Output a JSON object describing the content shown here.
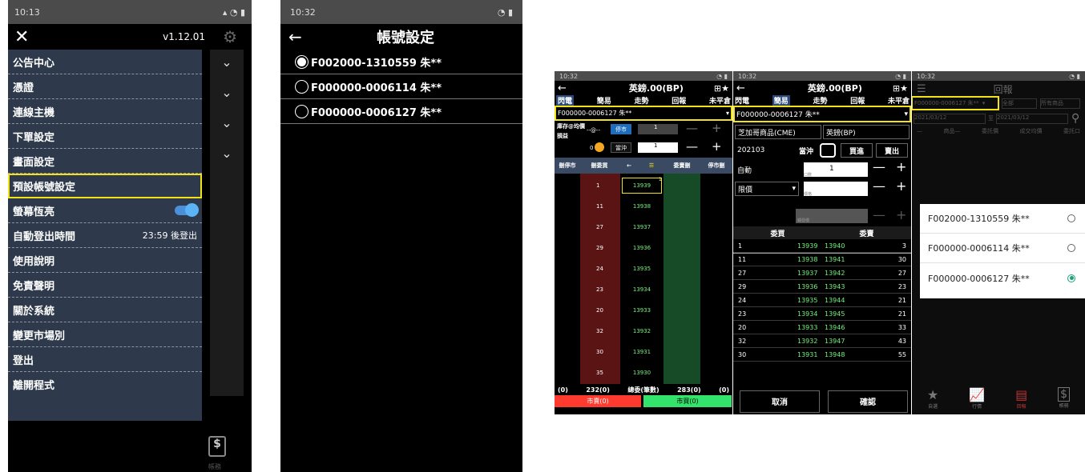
{
  "p1": {
    "status_time": "10:13",
    "version": "v1.12.01",
    "menu": [
      {
        "label": "公告中心"
      },
      {
        "label": "憑證"
      },
      {
        "label": "連線主機"
      },
      {
        "label": "下單設定"
      },
      {
        "label": "畫面設定"
      },
      {
        "label": "預設帳號設定"
      },
      {
        "label": "螢幕恆亮"
      },
      {
        "label": "自動登出時間",
        "value": "23:59 後登出"
      },
      {
        "label": "使用說明"
      },
      {
        "label": "免責聲明"
      },
      {
        "label": "關於系統"
      },
      {
        "label": "變更市場別"
      },
      {
        "label": "登出"
      },
      {
        "label": "離開程式"
      }
    ],
    "bottom_icon_label": "帳務"
  },
  "p2": {
    "status_time": "10:32",
    "title": "帳號設定",
    "accounts": [
      "F002000-1310559 朱**",
      "F000000-0006114 朱**",
      "F000000-0006127 朱**"
    ]
  },
  "p3": {
    "status_time": "10:32",
    "title": "英鎊.00(BP)",
    "tabs": [
      "閃電",
      "簡易",
      "走勢",
      "回報",
      "未平倉"
    ],
    "account": "F000000-0006127 朱**",
    "pos_label": "庫存@均價",
    "pos_value": "--@--",
    "pl_label": "損益",
    "pl_value": "0",
    "stop_label": "停市",
    "close_label": "當沖",
    "qty1": "1",
    "qty2": "1",
    "headers": [
      "刪停市",
      "刪委買",
      "←",
      "委賣刪",
      "停市刪"
    ],
    "ladder": [
      {
        "q": "1",
        "p": "13939",
        "mark": "1"
      },
      {
        "q": "11",
        "p": "13938"
      },
      {
        "q": "27",
        "p": "13937"
      },
      {
        "q": "29",
        "p": "13936"
      },
      {
        "q": "24",
        "p": "13935"
      },
      {
        "q": "23",
        "p": "13934"
      },
      {
        "q": "20",
        "p": "13933"
      },
      {
        "q": "32",
        "p": "13932"
      },
      {
        "q": "30",
        "p": "13931"
      },
      {
        "q": "35",
        "p": "13930"
      }
    ],
    "foot": [
      "(0)",
      "232(0)",
      "總委(筆數)",
      "283(0)",
      "(0)"
    ],
    "sell_btn": "市賣(0)",
    "buy_btn": "市買(0)"
  },
  "p4": {
    "status_time": "10:32",
    "title": "英鎊.00(BP)",
    "tabs": [
      "閃電",
      "簡易",
      "走勢",
      "回報",
      "未平倉"
    ],
    "account": "F000000-0006127 朱**",
    "exchange": "芝加哥商品(CME)",
    "product": "英鎊(BP)",
    "month": "202103",
    "daytrade": "當沖",
    "buy": "買進",
    "sell": "賣出",
    "auto": "自動",
    "qty": "1",
    "ordtype": "限價",
    "hint1": "口數",
    "hint2": "價格",
    "hint3": "觸發價",
    "col_buy": "委買",
    "col_sell": "委賣",
    "book": [
      [
        "1",
        "13939",
        "13940",
        "3"
      ],
      [
        "11",
        "13938",
        "13941",
        "30"
      ],
      [
        "27",
        "13937",
        "13942",
        "27"
      ],
      [
        "29",
        "13936",
        "13943",
        "23"
      ],
      [
        "24",
        "13935",
        "13944",
        "21"
      ],
      [
        "23",
        "13934",
        "13945",
        "21"
      ],
      [
        "20",
        "13933",
        "13946",
        "33"
      ],
      [
        "32",
        "13932",
        "13947",
        "43"
      ],
      [
        "30",
        "13931",
        "13948",
        "55"
      ]
    ],
    "cancel": "取消",
    "confirm": "確認"
  },
  "p5": {
    "status_time": "10:32",
    "title": "回報",
    "account": "F000000-0006127 朱**",
    "filter_all": "全部",
    "filter_prod": "所有商品",
    "date_from": "2021/03/12",
    "date_sep": "至",
    "date_to": "2021/03/12",
    "cols": [
      "—",
      "商品—",
      "委託價",
      "成交均價",
      "委託口"
    ],
    "popup": [
      "F002000-1310559 朱**",
      "F000000-0006114 朱**",
      "F000000-0006127 朱**"
    ],
    "nav": [
      "自選",
      "行情",
      "回報",
      "帳務"
    ]
  },
  "colors": {
    "accent": "#f1e21a",
    "menu_bg": "#2e3a4b",
    "green": "#74f27a",
    "sell_red": "#ff3b30",
    "buy_green": "#33e36b"
  }
}
